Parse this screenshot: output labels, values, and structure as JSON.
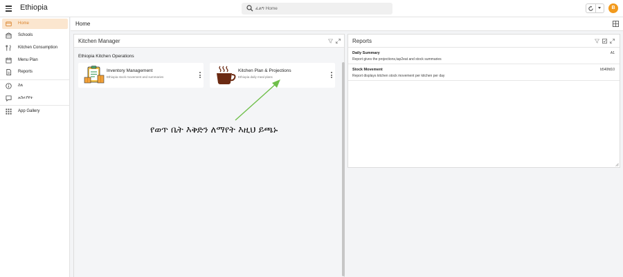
{
  "app": {
    "title": "Ethiopia"
  },
  "search": {
    "placeholder": "ፈልግ Home"
  },
  "user": {
    "avatar_initial": "B",
    "avatar_color": "#f29a1d"
  },
  "colors": {
    "accent": "#d9822b",
    "active_bg": "#fbe6cf",
    "arrow": "#6fbf4a"
  },
  "sidebar": {
    "items": [
      {
        "label": "Home",
        "icon": "home-icon",
        "active": true
      },
      {
        "label": "Schools",
        "icon": "school-icon",
        "active": false
      },
      {
        "label": "Kitchen Consumption",
        "icon": "utensils-icon",
        "active": false
      },
      {
        "label": "Menu Plan",
        "icon": "calendar-icon",
        "active": false
      },
      {
        "label": "Reports",
        "icon": "document-icon",
        "active": false
      },
      {
        "label": "ስለ",
        "icon": "info-icon",
        "active": false
      },
      {
        "label": "አስተያየት",
        "icon": "feedback-icon",
        "active": false
      },
      {
        "label": "App Gallery",
        "icon": "apps-grid-icon",
        "active": false
      }
    ]
  },
  "page": {
    "title": "Home"
  },
  "kitchen_manager": {
    "title": "Kitchen Manager",
    "subtitle": "Ethiopia Kitchen Operations",
    "cards": [
      {
        "title": "Inventory Management",
        "desc": "Ethiopia stock movement and summaries",
        "icon": "clipboard-boxes-icon"
      },
      {
        "title": "Kitchen Plan & Projections",
        "desc": "Ethiopia daily meal plans",
        "icon": "coffee-cup-icon"
      }
    ],
    "annotation": "የወጥ ቤት እቅድን ለማየት እዚህ ይጫኑ"
  },
  "reports": {
    "title": "Reports",
    "items": [
      {
        "name": "Daily Summary",
        "desc": "Report gives the projections,tap2eat and stock summaries",
        "code": "A1"
      },
      {
        "name": "Stock Movement",
        "desc": "Report displays kitchen stock movement per kitchen per day",
        "code": "b540fd10"
      }
    ]
  }
}
